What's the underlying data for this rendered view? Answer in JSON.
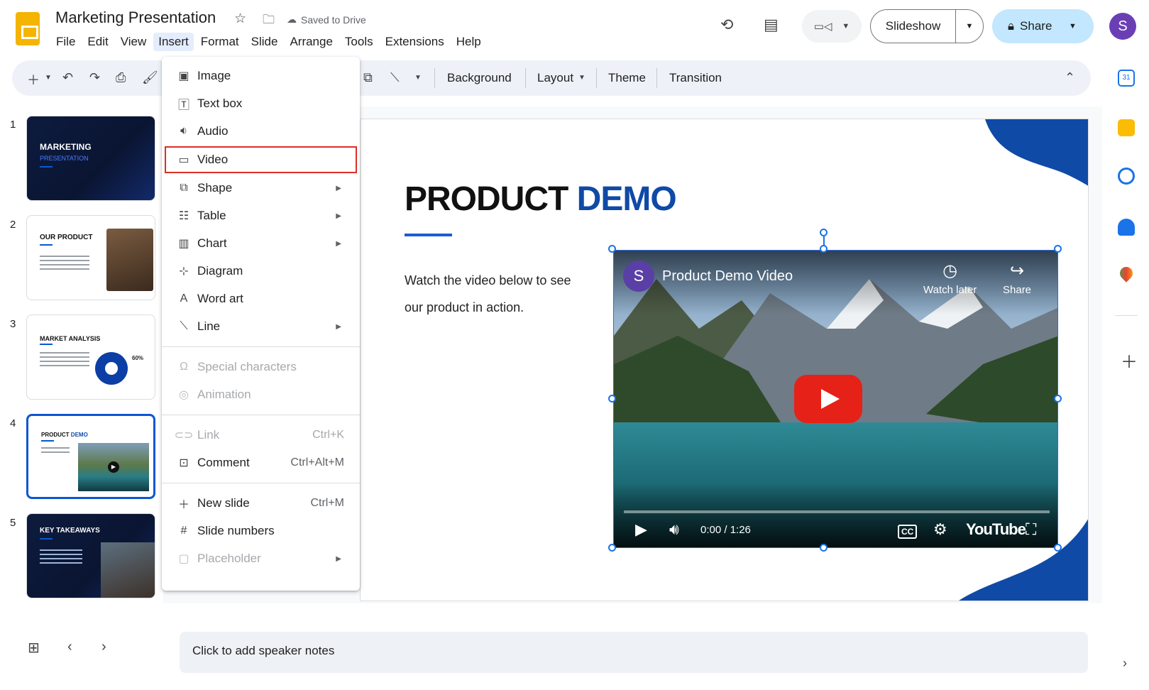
{
  "header": {
    "doc_title": "Marketing Presentation",
    "saved_status": "Saved to Drive",
    "menus": [
      "File",
      "Edit",
      "View",
      "Insert",
      "Format",
      "Slide",
      "Arrange",
      "Tools",
      "Extensions",
      "Help"
    ],
    "active_menu": "Insert",
    "slideshow_label": "Slideshow",
    "share_label": "Share",
    "avatar_letter": "S"
  },
  "toolbar": {
    "background_label": "Background",
    "layout_label": "Layout",
    "theme_label": "Theme",
    "transition_label": "Transition"
  },
  "filmstrip": {
    "slides": [
      {
        "num": "1",
        "title": "MARKETING",
        "subtitle": "PRESENTATION"
      },
      {
        "num": "2",
        "title": "OUR PRODUCT"
      },
      {
        "num": "3",
        "title": "MARKET ANALYSIS",
        "stat": "60%"
      },
      {
        "num": "4",
        "title": "PRODUCT",
        "title_accent": "DEMO"
      },
      {
        "num": "5",
        "title": "KEY TAKEAWAYS"
      }
    ],
    "selected_slide": 4
  },
  "slide": {
    "title": "PRODUCT",
    "title_accent": "DEMO",
    "body": "Watch the video below to see our product in action."
  },
  "video": {
    "channel_letter": "S",
    "title": "Product Demo Video",
    "watch_later": "Watch later",
    "share": "Share",
    "time": "0:00 / 1:26",
    "cc": "CC",
    "brand": "YouTube"
  },
  "notes": {
    "placeholder": "Click to add speaker notes"
  },
  "insert_menu": {
    "items": [
      {
        "label": "Image",
        "icon": "image-icon"
      },
      {
        "label": "Text box",
        "icon": "text-box-icon"
      },
      {
        "label": "Audio",
        "icon": "audio-icon"
      },
      {
        "label": "Video",
        "icon": "video-icon",
        "highlighted": true
      },
      {
        "label": "Shape",
        "icon": "shape-icon",
        "submenu": true
      },
      {
        "label": "Table",
        "icon": "table-icon",
        "submenu": true
      },
      {
        "label": "Chart",
        "icon": "chart-icon",
        "submenu": true
      },
      {
        "label": "Diagram",
        "icon": "diagram-icon"
      },
      {
        "label": "Word art",
        "icon": "word-art-icon"
      },
      {
        "label": "Line",
        "icon": "line-icon",
        "submenu": true
      },
      {
        "label": "Special characters",
        "icon": "omega-icon",
        "disabled": true
      },
      {
        "label": "Animation",
        "icon": "animation-icon",
        "disabled": true
      },
      {
        "label": "Link",
        "icon": "link-icon",
        "shortcut": "Ctrl+K",
        "disabled": true
      },
      {
        "label": "Comment",
        "icon": "comment-icon",
        "shortcut": "Ctrl+Alt+M"
      },
      {
        "label": "New slide",
        "icon": "plus-icon",
        "shortcut": "Ctrl+M"
      },
      {
        "label": "Slide numbers",
        "icon": "slide-numbers-icon"
      },
      {
        "label": "Placeholder",
        "icon": "placeholder-icon",
        "submenu": true,
        "disabled": true
      }
    ]
  },
  "colors": {
    "accent_blue": "#0b57d0",
    "share_bg": "#c2e7ff",
    "highlight_red": "#d93025",
    "youtube_red": "#e62117"
  }
}
